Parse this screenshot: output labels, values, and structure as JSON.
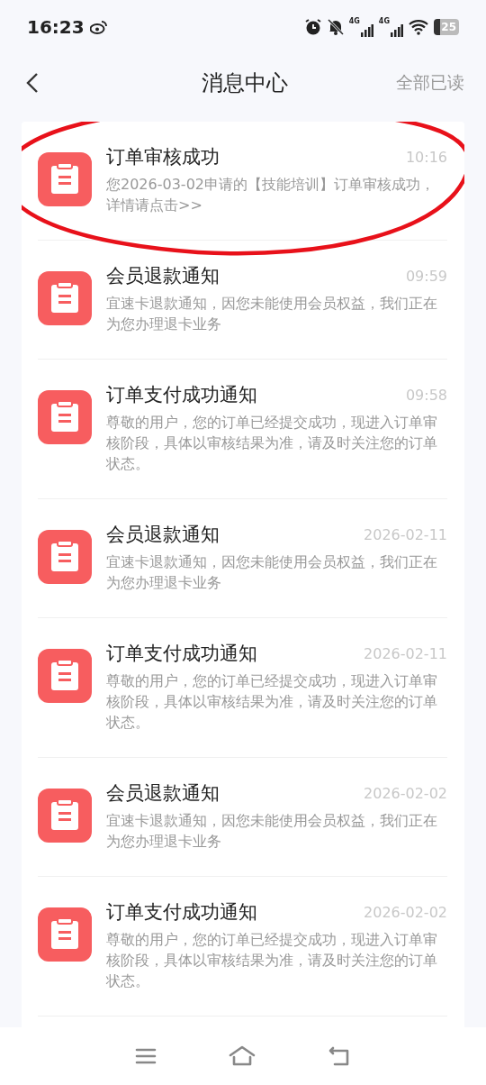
{
  "status_bar": {
    "time": "16:23",
    "signals": [
      "4G",
      "4G"
    ],
    "battery": "25"
  },
  "header": {
    "title": "消息中心",
    "action": "全部已读"
  },
  "messages": [
    {
      "title": "订单审核成功",
      "time": "10:16",
      "text": "您2026-03-02申请的【技能培训】订单审核成功，详情请点击>>",
      "circled": true
    },
    {
      "title": "会员退款通知",
      "time": "09:59",
      "text": "宜速卡退款通知，因您未能使用会员权益，我们正在为您办理退卡业务",
      "circled": false
    },
    {
      "title": "订单支付成功通知",
      "time": "09:58",
      "text": "尊敬的用户，您的订单已经提交成功，现进入订单审核阶段，具体以审核结果为准，请及时关注您的订单状态。",
      "circled": false
    },
    {
      "title": "会员退款通知",
      "time": "2026-02-11",
      "text": "宜速卡退款通知，因您未能使用会员权益，我们正在为您办理退卡业务",
      "circled": false
    },
    {
      "title": "订单支付成功通知",
      "time": "2026-02-11",
      "text": "尊敬的用户，您的订单已经提交成功，现进入订单审核阶段，具体以审核结果为准，请及时关注您的订单状态。",
      "circled": false
    },
    {
      "title": "会员退款通知",
      "time": "2026-02-02",
      "text": "宜速卡退款通知，因您未能使用会员权益，我们正在为您办理退卡业务",
      "circled": false
    },
    {
      "title": "订单支付成功通知",
      "time": "2026-02-02",
      "text": "尊敬的用户，您的订单已经提交成功，现进入订单审核阶段，具体以审核结果为准，请及时关注您的订单状态。",
      "circled": false
    }
  ]
}
